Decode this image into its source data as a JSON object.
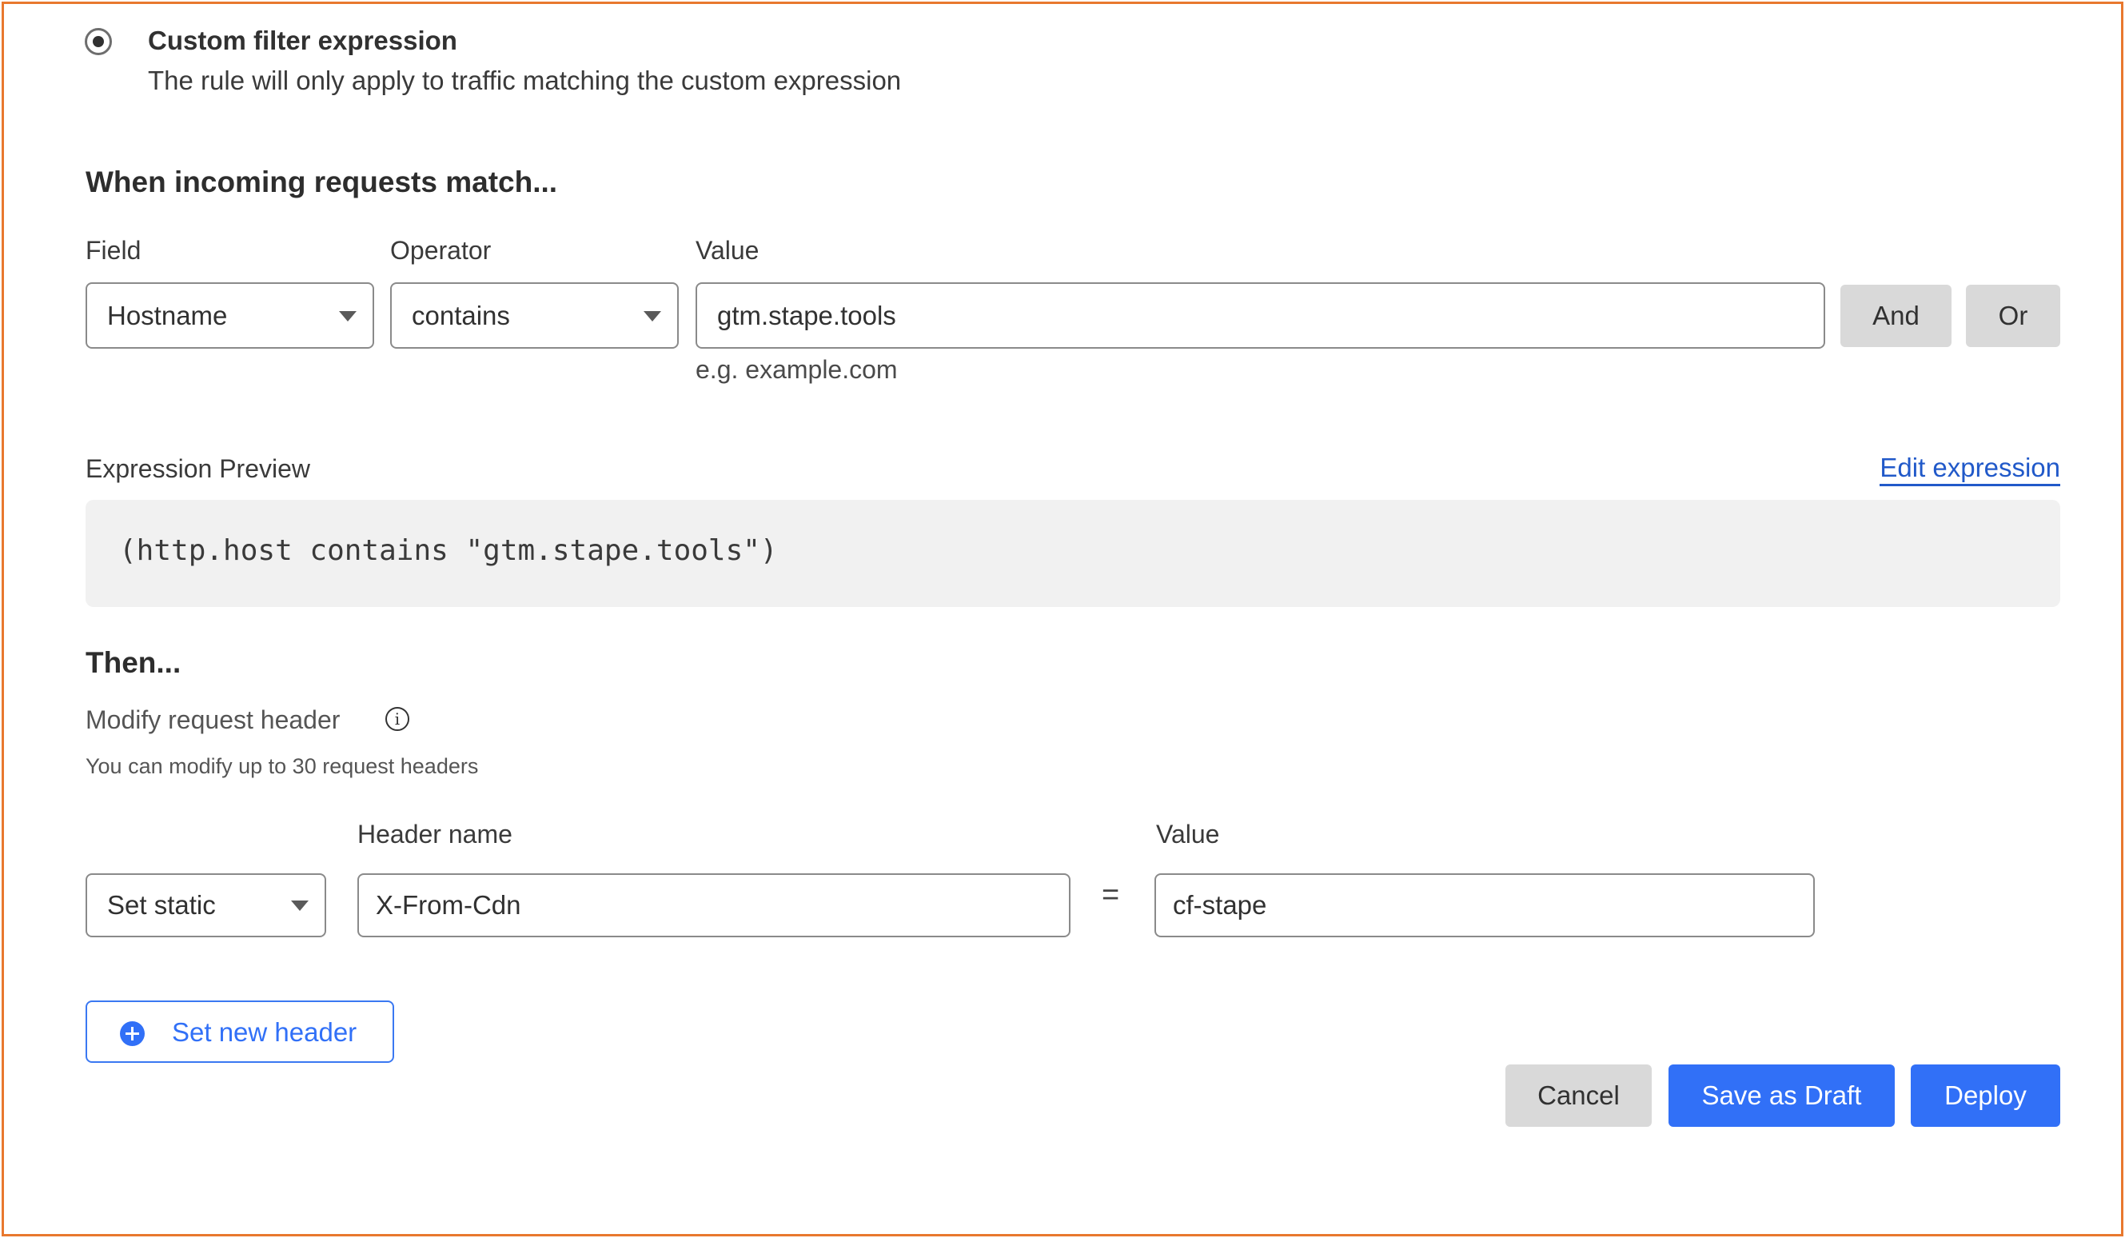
{
  "filter_option": {
    "selected": true,
    "title": "Custom filter expression",
    "description": "The rule will only apply to traffic matching the custom expression"
  },
  "match_section": {
    "heading": "When incoming requests match...",
    "field_label": "Field",
    "operator_label": "Operator",
    "value_label": "Value",
    "field_value": "Hostname",
    "operator_value": "contains",
    "value_value": "gtm.stape.tools",
    "value_hint": "e.g. example.com",
    "and_label": "And",
    "or_label": "Or"
  },
  "expression_preview": {
    "label": "Expression Preview",
    "edit_link": "Edit expression",
    "expression": "(http.host contains \"gtm.stape.tools\")"
  },
  "then_section": {
    "heading": "Then...",
    "action_label": "Modify request header",
    "action_hint": "You can modify up to 30 request headers",
    "info_icon": "info-icon",
    "header_name_label": "Header name",
    "value_label": "Value",
    "operation_value": "Set static",
    "header_name_value": "X-From-Cdn",
    "equals_sign": "=",
    "header_value": "cf-stape",
    "add_header_label": "Set new header"
  },
  "actions": {
    "cancel_label": "Cancel",
    "save_draft_label": "Save as Draft",
    "deploy_label": "Deploy"
  },
  "colors": {
    "accent": "#3170f7",
    "link": "#2159c9",
    "frame_border": "#e8782e",
    "secondary_button": "#d9d9d9",
    "preview_bg": "#f1f1f1"
  }
}
